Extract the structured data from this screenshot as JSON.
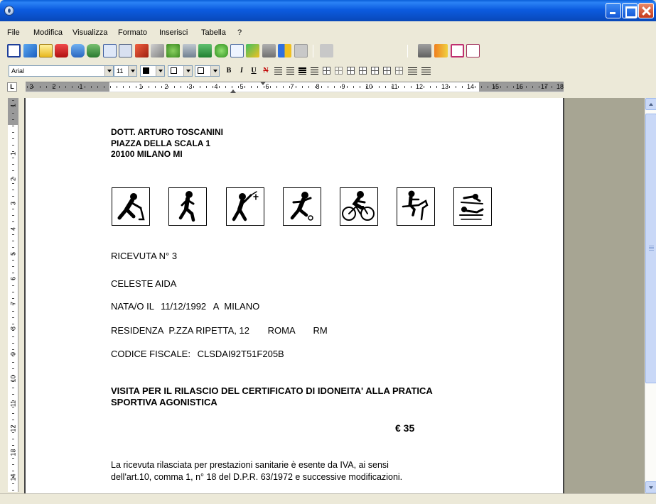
{
  "menu": [
    "File",
    "Modifica",
    "Visualizza",
    "Formato",
    "Inserisci",
    "Tabella",
    "?"
  ],
  "toolbar2": {
    "font_name": "Arial",
    "font_size": "11",
    "bold": "B",
    "italic": "I",
    "underline": "U",
    "strike": "N"
  },
  "ruler_h": [
    "3",
    "2",
    "1",
    "1",
    "2",
    "3",
    "4",
    "5",
    "6",
    "7",
    "8",
    "9",
    "10",
    "11",
    "12",
    "13",
    "14",
    "15",
    "16",
    "17",
    "18"
  ],
  "ruler_v": [
    "1",
    "1",
    "2",
    "3",
    "4",
    "5",
    "6",
    "7",
    "8",
    "9",
    "10",
    "11",
    "12",
    "13",
    "14"
  ],
  "ruler_corner": "L",
  "document": {
    "doctor_name": "DOTT. ARTURO TOSCANINI",
    "doctor_address": "PIAZZA DELLA SCALA 1",
    "doctor_city": "20100 MILANO MI",
    "receipt": "RICEVUTA N° 3",
    "patient": "CELESTE   AIDA",
    "birth_label": "NATA/O  IL",
    "birth_date": "11/12/1992",
    "birth_place_label": "A",
    "birth_place": "MILANO",
    "residence_label": "RESIDENZA",
    "residence_street": "P.ZZA RIPETTA, 12",
    "residence_city": "ROMA",
    "residence_prov": "RM",
    "cf_label": "CODICE FISCALE:",
    "cf_value": "CLSDAI92T51F205B",
    "visit_line1": "VISITA PER IL RILASCIO DEL CERTIFICATO DI IDONEITA' ALLA PRATICA",
    "visit_line2": "SPORTIVA AGONISTICA",
    "amount": "€  35",
    "note_line1": "La ricevuta rilasciata per prestazioni sanitarie è esente da IVA, ai sensi",
    "note_line2": "dell'art.10, comma 1, n° 18 del D.P.R. 63/1972  e successive modificazioni."
  },
  "pictograms": [
    "hockey-icon",
    "running-icon",
    "fencing-icon",
    "tennis-icon",
    "cycling-icon",
    "equestrian-icon",
    "swimming-icon"
  ]
}
